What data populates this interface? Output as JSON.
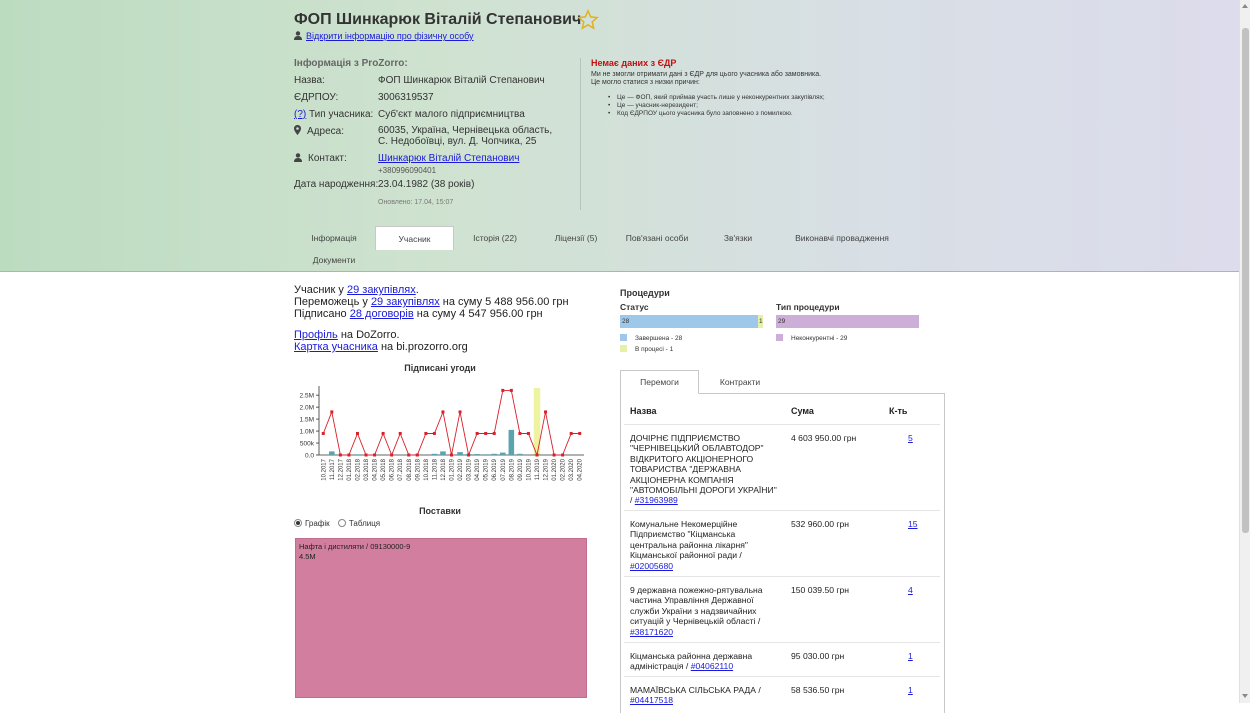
{
  "header": {
    "title": "ФОП Шинкарюк Віталій Степанович",
    "open_info_link": "Відкрити інформацію про фізичну особу"
  },
  "info": {
    "heading": "Інформація з ProZorro:",
    "name_label": "Назва:",
    "name_value": "ФОП Шинкарюк Віталій Степанович",
    "edrpou_label": "ЄДРПОУ:",
    "edrpou_value": "3006319537",
    "help_link": "(?)",
    "type_label": "Тип учасника:",
    "type_value": "Суб'єкт малого підприємництва",
    "address_label": "Адреса:",
    "address_value": "60035, Україна, Чернівецька область, С. Недобоївці, вул. Д. Чопчика, 25",
    "contact_label": "Контакт:",
    "contact_name": "Шинкарюк Віталій Степанович",
    "contact_phone": "+380996090401",
    "birth_label": "Дата народження:",
    "birth_value": "23.04.1982 (38 років)",
    "updated": "Оновлено: 17.04, 15:07"
  },
  "edr": {
    "title": "Немає даних з ЄДР",
    "text1": "Ми не змогли отримати дані з ЄДР для цього учасника або замовника.",
    "text2": "Це могло статися з низки причин:",
    "reasons": [
      "Це — ФОП, який приймав участь лише у неконкурентних закупівлях;",
      "Це — учасник-нерезидент;",
      "Код ЄДРПОУ цього учасника було заповнено з помилкою."
    ]
  },
  "tabs": [
    "Інформація",
    "Учасник",
    "Історія (22)",
    "Ліцензії (5)",
    "Пов'язані особи",
    "Зв'язки",
    "Виконавчі провадження",
    "Документи"
  ],
  "summary": {
    "l1_pre": "Учасник у ",
    "l1_link": "29 закупівлях",
    "l1_post": ".",
    "l2_pre": "Переможець у ",
    "l2_link": "29 закупівлях",
    "l2_post": " на суму 5 488 956.00 грн",
    "l3_pre": "Підписано ",
    "l3_link": "28 договорів",
    "l3_post": " на суму 4 547 956.00 грн"
  },
  "links": {
    "profile_link": "Профіль",
    "profile_post": " на DoZorro.",
    "card_link": "Картка учасника",
    "card_post": " на bi.prozorro.org"
  },
  "chart_data": {
    "type": "bar",
    "title": "Підписані угоди",
    "categories": [
      "10.2017",
      "11.2017",
      "12.2017",
      "01.2018",
      "02.2018",
      "03.2018",
      "04.2018",
      "05.2018",
      "06.2018",
      "07.2018",
      "08.2018",
      "09.2018",
      "10.2018",
      "11.2018",
      "12.2018",
      "01.2019",
      "02.2019",
      "03.2019",
      "04.2019",
      "05.2019",
      "06.2019",
      "07.2019",
      "08.2019",
      "09.2019",
      "10.2019",
      "11.2019",
      "12.2019",
      "01.2020",
      "02.2020",
      "03.2020",
      "04.2020"
    ],
    "y_ticks": [
      "0.0",
      "500k",
      "1.0M",
      "1.5M",
      "2.0M",
      "2.5M"
    ],
    "ylim": [
      0,
      2800000
    ],
    "bars": [
      0,
      150000,
      0,
      0,
      30000,
      0,
      0,
      0,
      0,
      0,
      0,
      30000,
      0,
      50000,
      150000,
      0,
      120000,
      40000,
      40000,
      30000,
      50000,
      100000,
      1050000,
      50000,
      0,
      0,
      0,
      0,
      0,
      0,
      0
    ],
    "line": [
      900000,
      1800000,
      0,
      0,
      900000,
      0,
      0,
      900000,
      0,
      900000,
      0,
      0,
      900000,
      900000,
      1800000,
      0,
      1800000,
      0,
      900000,
      900000,
      900000,
      2700000,
      2700000,
      900000,
      900000,
      0,
      1800000,
      0,
      0,
      900000,
      900000
    ],
    "highlight_index": 25,
    "colors": {
      "bar": "#5ba3ad",
      "line": "#d9202b",
      "highlight": "#eef3a0"
    }
  },
  "supplies": {
    "title": "Поставки",
    "opt_graph": "Графік",
    "opt_table": "Таблиця",
    "treemap_label": "Нафта і дистиляти / 09130000-9",
    "treemap_value": "4.5M",
    "treemap_color": "#d27e9e"
  },
  "procedures": {
    "heading": "Процедури",
    "status_heading": "Статус",
    "type_heading": "Тип процедури",
    "status_bar_main": "28",
    "status_bar_small": "1",
    "type_bar": "29",
    "legend_done": "Завершена - 28",
    "legend_process": "В процесі - 1",
    "legend_noncomp": "Неконкурентні - 29",
    "colors": {
      "done": "#9ec8ea",
      "process": "#e6f0a8",
      "noncomp": "#ccaed8"
    }
  },
  "table": {
    "tab_wins": "Перемоги",
    "tab_contracts": "Контракти",
    "col_name": "Назва",
    "col_sum": "Сума",
    "col_count": "К-ть",
    "rows": [
      {
        "name": "ДОЧІРНЄ ПІДПРИЄМСТВО \"ЧЕРНІВЕЦЬКИЙ ОБЛАВТОДОР\" ВІДКРИТОГО АКЦІОНЕРНОГО ТОВАРИСТВА \"ДЕРЖАВНА АКЦІОНЕРНА КОМПАНІЯ \"АВТОМОБІЛЬНІ ДОРОГИ УКРАЇНИ\" / ",
        "code": "#31963989",
        "sum": "4 603 950.00 грн",
        "count": "5"
      },
      {
        "name": "Комунальне Некомерційне Підприємство \"Кіцманська центральна районна лікарня\" Кіцманської районної ради / ",
        "code": "#02005680",
        "sum": "532 960.00 грн",
        "count": "15"
      },
      {
        "name": "9 державна пожежно-рятувальна частина Управління Державної служби України з надзвичайних ситуацій у Чернівецькій області / ",
        "code": "#38171620",
        "sum": "150 039.50 грн",
        "count": "4"
      },
      {
        "name": "Кіцманська районна державна адміністрація / ",
        "code": "#04062110",
        "sum": "95 030.00 грн",
        "count": "1"
      },
      {
        "name": "МАМАЇВСЬКА СІЛЬСЬКА РАДА / ",
        "code": "#04417518",
        "sum": "58 536.50 грн",
        "count": "1"
      }
    ]
  }
}
